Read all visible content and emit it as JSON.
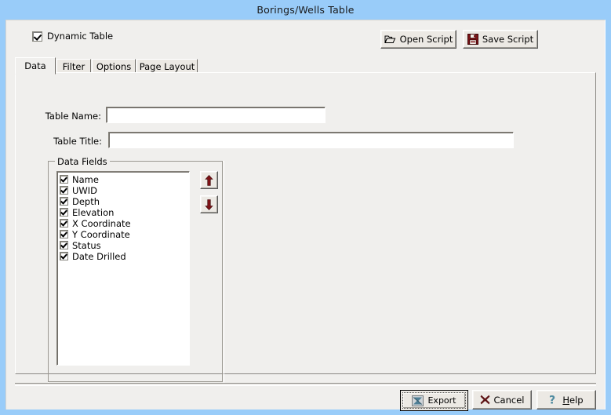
{
  "window": {
    "title": "Borings/Wells Table",
    "titlebar_color": "#99ccf9",
    "body_color": "#f0efed"
  },
  "toolbar": {
    "dynamic_table": {
      "label": "Dynamic Table",
      "checked": true,
      "icon": "checkbox-checked-icon"
    },
    "open_script": {
      "label": "Open Script",
      "icon": "folder-open-icon"
    },
    "save_script": {
      "label": "Save Script",
      "icon": "floppy-disk-icon",
      "icon_color": "#7d1216"
    }
  },
  "tabs": [
    {
      "label": "Data",
      "active": true
    },
    {
      "label": "Filter",
      "active": false
    },
    {
      "label": "Options",
      "active": false
    },
    {
      "label": "Page Layout",
      "active": false
    }
  ],
  "data_tab": {
    "table_name": {
      "label": "Table Name:",
      "value": "",
      "placeholder": ""
    },
    "table_title": {
      "label": "Table Title:",
      "value": "",
      "placeholder": ""
    },
    "data_fields": {
      "group_label": "Data Fields",
      "items": [
        {
          "label": "Name",
          "checked": true
        },
        {
          "label": "UWID",
          "checked": true
        },
        {
          "label": "Depth",
          "checked": true
        },
        {
          "label": "Elevation",
          "checked": true
        },
        {
          "label": "X Coordinate",
          "checked": true
        },
        {
          "label": "Y Coordinate",
          "checked": true
        },
        {
          "label": "Status",
          "checked": true
        },
        {
          "label": "Date Drilled",
          "checked": true
        }
      ],
      "move_up": {
        "icon": "arrow-up-icon",
        "color": "#7d1216"
      },
      "move_down": {
        "icon": "arrow-down-icon",
        "color": "#7d1216"
      }
    }
  },
  "footer": {
    "export": {
      "label": "Export",
      "icon": "export-icon",
      "default": true
    },
    "cancel": {
      "label": "Cancel",
      "icon": "x-mark-icon",
      "icon_color": "#5e1416"
    },
    "help": {
      "label": "Help",
      "hotkey": "H",
      "rest": "elp",
      "icon": "question-mark-icon",
      "icon_color": "#4f8ba0"
    }
  }
}
